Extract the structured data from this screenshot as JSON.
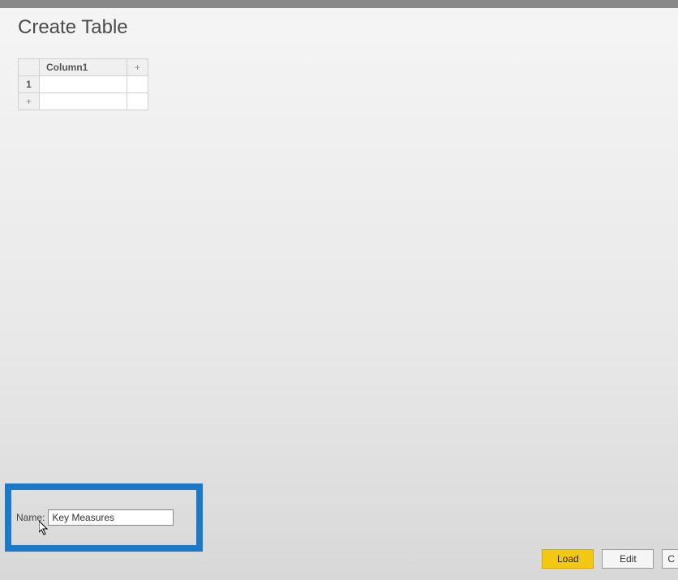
{
  "dialog": {
    "title": "Create Table"
  },
  "table": {
    "column_header": "Column1",
    "add_column_symbol": "+",
    "row_number": "1",
    "add_row_symbol": "+",
    "cell_value": ""
  },
  "name_field": {
    "label": "Name:",
    "value": "Key Measures"
  },
  "buttons": {
    "load": "Load",
    "edit": "Edit",
    "cancel_partial": "C"
  }
}
